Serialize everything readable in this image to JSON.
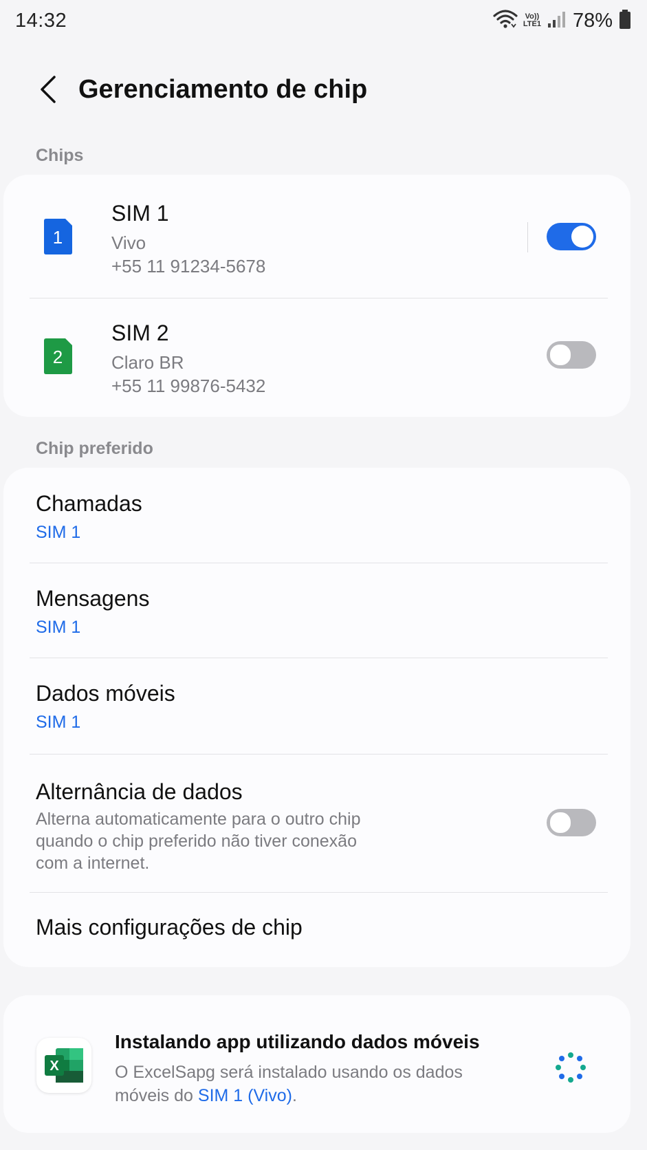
{
  "status_bar": {
    "time": "14:32",
    "network_label_top": "Vo))",
    "network_label_bottom": "LTE1",
    "battery": "78%",
    "icons": [
      "wifi-icon",
      "volte-icon",
      "signal-icon",
      "battery-icon"
    ]
  },
  "header": {
    "title": "Gerenciamento de chip",
    "back_icon": "chevron-left-icon"
  },
  "chips_section": {
    "label": "Chips",
    "sims": [
      {
        "badge": "1",
        "name": "SIM 1",
        "carrier": "Vivo",
        "number": "+55 11 91234-5678",
        "enabled": true,
        "color": "#1565e0"
      },
      {
        "badge": "2",
        "name": "SIM 2",
        "carrier": "Claro BR",
        "number": "+55 11 99876-5432",
        "enabled": false,
        "color": "#1e9a45"
      }
    ]
  },
  "preferred_section": {
    "label": "Chip preferido",
    "calls": {
      "title": "Chamadas",
      "value": "SIM 1"
    },
    "messages": {
      "title": "Mensagens",
      "value": "SIM 1"
    },
    "mobile_data": {
      "title": "Dados móveis",
      "value": "SIM 1"
    },
    "data_switching": {
      "title": "Alternância de dados",
      "description": "Alterna automaticamente para o outro chip quando o chip preferido não tiver conexão com a internet.",
      "enabled": false
    },
    "more": {
      "title": "Mais configurações de chip"
    }
  },
  "notification": {
    "title": "Instalando app utilizando dados móveis",
    "body_prefix": "O ExcelSapg será instalado usando os dados móveis do ",
    "body_highlight": "SIM 1 (Vivo)",
    "body_suffix": ".",
    "app_icon": "excel-app-icon",
    "app_icon_letter": "X",
    "spinner_icon": "loading-spinner-icon"
  },
  "colors": {
    "accent": "#1f6be8",
    "background": "#f5f5f7",
    "card": "#fcfcfe",
    "secondary_text": "#7b7b80"
  }
}
